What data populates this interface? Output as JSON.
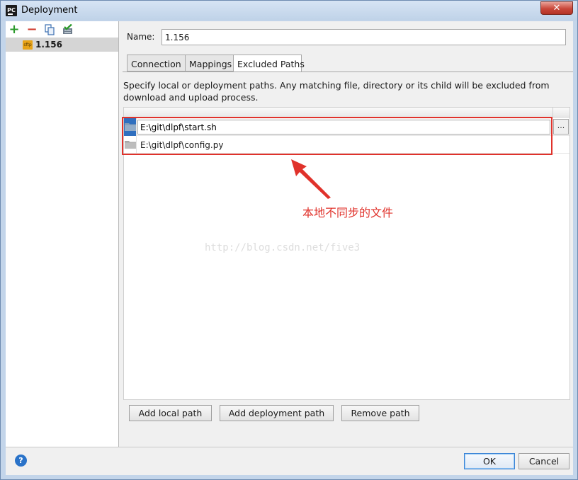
{
  "window": {
    "title": "Deployment",
    "app_icon_text": "PC",
    "close_label": "✕"
  },
  "sidebar": {
    "toolbar": {
      "add_icon": "plus-icon",
      "remove_icon": "minus-icon",
      "copy_icon": "copy-icon",
      "default_icon": "check-server-icon"
    },
    "items": [
      {
        "icon_text": "sftp",
        "label": "1.156"
      }
    ]
  },
  "form": {
    "name_label": "Name:",
    "name_value": "1.156"
  },
  "tabs": [
    {
      "label": "Connection",
      "active": false
    },
    {
      "label": "Mappings",
      "active": false
    },
    {
      "label": "Excluded Paths",
      "active": true
    }
  ],
  "excluded_paths": {
    "description": "Specify local or deployment paths. Any matching file, directory or its child will be excluded from download and upload process.",
    "rows": [
      {
        "path": "E:\\git\\dlpf\\start.sh",
        "editing": true
      },
      {
        "path": "E:\\git\\dlpf\\config.py",
        "editing": false
      }
    ],
    "browse_label": "...",
    "buttons": {
      "add_local": "Add local path",
      "add_deployment": "Add deployment path",
      "remove": "Remove path"
    }
  },
  "annotation": {
    "text": "本地不同步的文件",
    "color": "#e0322b"
  },
  "watermark": "http://blog.csdn.net/five3",
  "footer": {
    "help_label": "?",
    "ok_label": "OK",
    "cancel_label": "Cancel"
  }
}
